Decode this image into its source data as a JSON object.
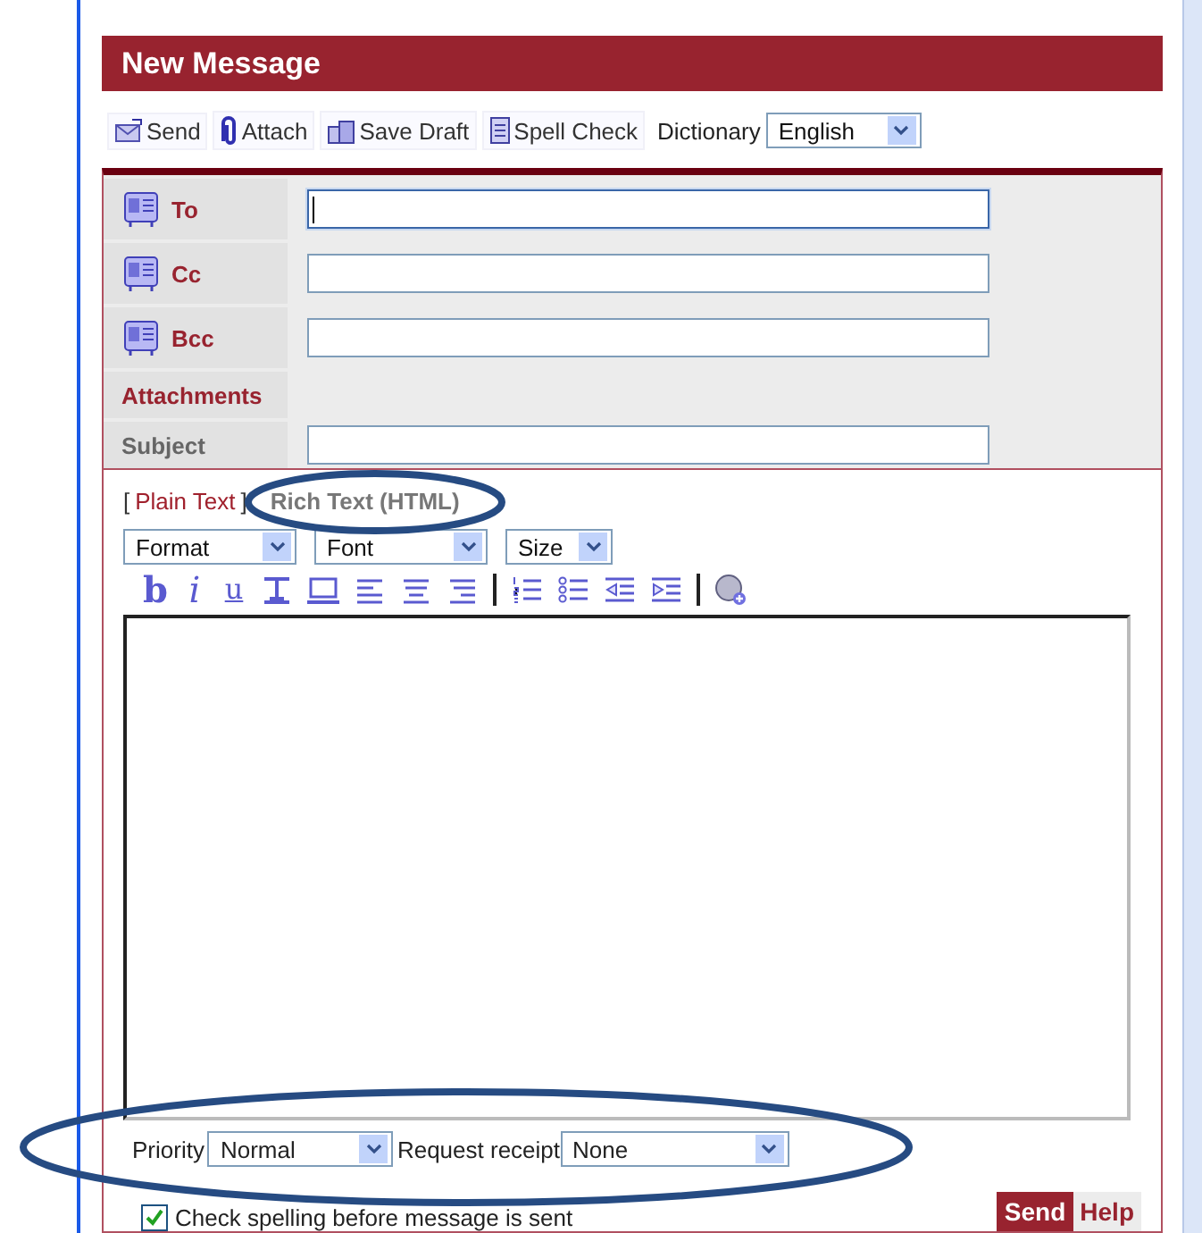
{
  "window": {
    "title": "New Message"
  },
  "toolbar": [
    {
      "label": "Send",
      "kind": "send"
    },
    {
      "label": "Attach",
      "kind": "attach"
    },
    {
      "label": "Save Draft",
      "kind": "save"
    },
    {
      "label": "Spell Check",
      "kind": "spell"
    }
  ],
  "dictionary": {
    "label": "Dictionary",
    "value": "English"
  },
  "recipients": [
    {
      "label": "To",
      "focused": true
    },
    {
      "label": "Cc",
      "focused": false
    },
    {
      "label": "Bcc",
      "focused": false
    }
  ],
  "attachments": {
    "label": "Attachments"
  },
  "subject": {
    "label": "Subject"
  },
  "mode_switch": {
    "open": "[",
    "close": "]",
    "modes": [
      {
        "label": "Plain Text",
        "selected": false
      },
      {
        "label": "Rich Text (HTML)",
        "selected": true
      }
    ]
  },
  "style_selects": [
    {
      "value": "Format"
    },
    {
      "value": "Font"
    },
    {
      "value": "Size"
    }
  ],
  "format_tools": [
    {
      "kind": "bold",
      "glyph": "b"
    },
    {
      "kind": "italic",
      "glyph": "i"
    },
    {
      "kind": "underline",
      "glyph": "u"
    },
    {
      "kind": "text-style"
    },
    {
      "kind": "box"
    },
    {
      "kind": "align-left"
    },
    {
      "kind": "align-center"
    },
    {
      "kind": "align-right"
    },
    {
      "kind": "separator"
    },
    {
      "kind": "numbered-list"
    },
    {
      "kind": "bullet-list"
    },
    {
      "kind": "outdent"
    },
    {
      "kind": "indent"
    },
    {
      "kind": "separator"
    },
    {
      "kind": "link"
    }
  ],
  "priority": {
    "label": "Priority",
    "value": "Normal"
  },
  "receipt": {
    "label": "Request receipt",
    "value": "None"
  },
  "spellcheck": {
    "label": "Check spelling before message is sent",
    "checked": true
  },
  "buttons": [
    {
      "label": "Send",
      "kind": "primary"
    },
    {
      "label": "Help",
      "kind": "secondary"
    }
  ]
}
